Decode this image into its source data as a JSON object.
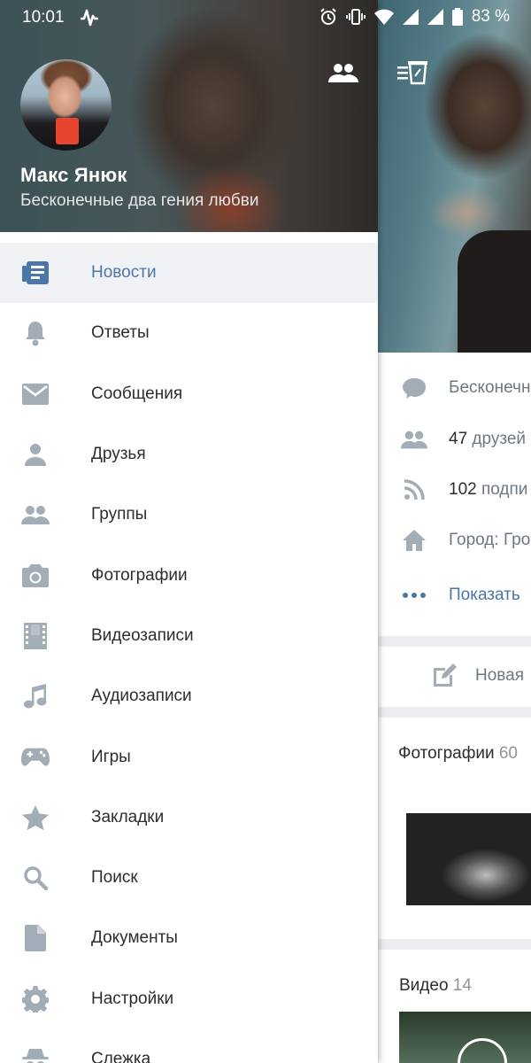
{
  "status_bar": {
    "time": "10:01",
    "battery": "83 %"
  },
  "profile": {
    "name": "Макс Янюк",
    "status": "Бесконечные два гения любви"
  },
  "menu": [
    {
      "label": "Новости",
      "icon": "newspaper-icon",
      "active": true
    },
    {
      "label": "Ответы",
      "icon": "bell-icon"
    },
    {
      "label": "Сообщения",
      "icon": "envelope-icon"
    },
    {
      "label": "Друзья",
      "icon": "person-icon"
    },
    {
      "label": "Группы",
      "icon": "group-icon"
    },
    {
      "label": "Фотографии",
      "icon": "camera-icon"
    },
    {
      "label": "Видеозаписи",
      "icon": "film-icon"
    },
    {
      "label": "Аудиозаписи",
      "icon": "music-note-icon"
    },
    {
      "label": "Игры",
      "icon": "gamepad-icon"
    },
    {
      "label": "Закладки",
      "icon": "star-icon"
    },
    {
      "label": "Поиск",
      "icon": "search-icon"
    },
    {
      "label": "Документы",
      "icon": "document-icon"
    },
    {
      "label": "Настройки",
      "icon": "gear-icon"
    },
    {
      "label": "Слежка",
      "icon": "spy-icon"
    }
  ],
  "background_profile": {
    "status_text": "Бесконечн",
    "friends_count": "47",
    "friends_text": "друзей",
    "followers_count": "102",
    "followers_text": "подпи",
    "city_text": "Город: Гро",
    "show_more": "Показать",
    "new_post": "Новая",
    "photos_title": "Фотографии",
    "photos_count": "60",
    "video_title": "Видео",
    "video_count": "14"
  },
  "colors": {
    "accent": "#4a76a8",
    "icon_gray": "#a3adb8",
    "text": "#2c2d2e"
  }
}
